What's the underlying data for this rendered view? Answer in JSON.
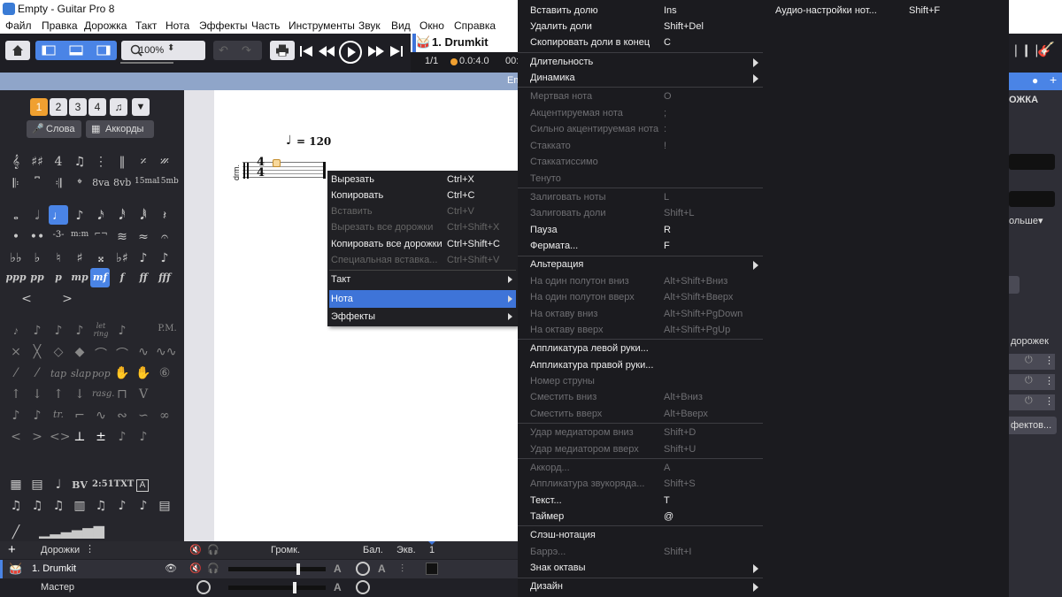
{
  "window": {
    "title": "Empty - Guitar Pro 8"
  },
  "menubar": [
    "Файл",
    "Правка",
    "Дорожка",
    "Такт",
    "Нота",
    "Эффекты",
    "Часть",
    "Инструменты",
    "Звук",
    "Вид",
    "Окно",
    "Справка"
  ],
  "toolbar": {
    "zoom": "100%",
    "track_name": "1. Drumkit",
    "bar_position": "1/1",
    "time_position": "0.0:4.0",
    "time_partial": "00:"
  },
  "track_strip": {
    "title_partial": "Em"
  },
  "palette": {
    "voices": [
      "1",
      "2",
      "3",
      "4"
    ],
    "lyrics_button": "Слова",
    "chords_button": "Аккорды",
    "ottava_labels": [
      "8va",
      "8vb",
      "15ma",
      "15mb"
    ],
    "dynamics": [
      "ppp",
      "pp",
      "p",
      "mp",
      "mf",
      "f",
      "ff",
      "fff"
    ],
    "technique_labels": [
      "tap",
      "slap",
      "pop",
      "rasg.",
      "let ring",
      "P.M."
    ],
    "misc_labels": [
      "BV",
      "2:51",
      "TXT",
      "A"
    ]
  },
  "score": {
    "tempo": "= 120",
    "track_label": "drm."
  },
  "mixer": {
    "header": {
      "tracks_label": "Дорожки",
      "volume_label": "Громк.",
      "balance_label": "Бал.",
      "eq_label": "Экв.",
      "bar_number": "1"
    },
    "rows": [
      {
        "name": "1. Drumkit"
      },
      {
        "name": "Мастер"
      }
    ]
  },
  "right_panel": {
    "labels": [
      "ОЖКА",
      "ольше▾",
      "дорожек",
      "фектов..."
    ]
  },
  "context_menu": {
    "items": [
      {
        "label": "Вырезать",
        "shortcut": "Ctrl+X",
        "disabled": false
      },
      {
        "label": "Копировать",
        "shortcut": "Ctrl+C",
        "disabled": false
      },
      {
        "label": "Вставить",
        "shortcut": "Ctrl+V",
        "disabled": true
      },
      {
        "label": "Вырезать все дорожки",
        "shortcut": "Ctrl+Shift+X",
        "disabled": true
      },
      {
        "label": "Копировать все дорожки",
        "shortcut": "Ctrl+Shift+C",
        "disabled": false
      },
      {
        "label": "Специальная вставка...",
        "shortcut": "Ctrl+Shift+V",
        "disabled": true
      },
      {
        "label": "Такт",
        "shortcut": "",
        "disabled": false,
        "submenu": true
      },
      {
        "label": "Нота",
        "shortcut": "",
        "disabled": false,
        "submenu": true,
        "highlighted": true
      },
      {
        "label": "Эффекты",
        "shortcut": "",
        "disabled": false,
        "submenu": true
      }
    ]
  },
  "note_menu": {
    "items": [
      {
        "label": "Вставить долю",
        "shortcut": "Ins",
        "disabled": false
      },
      {
        "label": "Удалить доли",
        "shortcut": "Shift+Del",
        "disabled": false
      },
      {
        "label": "Скопировать доли в конец",
        "shortcut": "C",
        "disabled": false
      },
      {
        "label": "Длительность",
        "shortcut": "",
        "submenu": true
      },
      {
        "label": "Динамика",
        "shortcut": "",
        "submenu": true
      },
      {
        "label": "Мертвая нота",
        "shortcut": "O",
        "disabled": true
      },
      {
        "label": "Акцентируемая нота",
        "shortcut": ";",
        "disabled": true
      },
      {
        "label": "Сильно акцентируемая нота",
        "shortcut": ":",
        "disabled": true
      },
      {
        "label": "Стаккато",
        "shortcut": "!",
        "disabled": true
      },
      {
        "label": "Стаккатиссимо",
        "shortcut": "",
        "disabled": true
      },
      {
        "label": "Тенуто",
        "shortcut": "",
        "disabled": true
      },
      {
        "label": "Залиговать ноты",
        "shortcut": "L",
        "disabled": true
      },
      {
        "label": "Залиговать доли",
        "shortcut": "Shift+L",
        "disabled": true
      },
      {
        "label": "Пауза",
        "shortcut": "R",
        "disabled": false
      },
      {
        "label": "Фермата...",
        "shortcut": "F",
        "disabled": false
      },
      {
        "label": "Альтерация",
        "shortcut": "",
        "submenu": true
      },
      {
        "label": "На один полутон вниз",
        "shortcut": "Alt+Shift+Вниз",
        "disabled": true
      },
      {
        "label": "На один полутон вверх",
        "shortcut": "Alt+Shift+Вверх",
        "disabled": true
      },
      {
        "label": "На октаву вниз",
        "shortcut": "Alt+Shift+PgDown",
        "disabled": true
      },
      {
        "label": "На октаву вверх",
        "shortcut": "Alt+Shift+PgUp",
        "disabled": true
      },
      {
        "label": "Аппликатура левой руки...",
        "shortcut": "",
        "disabled": false
      },
      {
        "label": "Аппликатура правой руки...",
        "shortcut": "",
        "disabled": false
      },
      {
        "label": "Номер струны",
        "shortcut": "",
        "disabled": true
      },
      {
        "label": "Сместить вниз",
        "shortcut": "Alt+Вниз",
        "disabled": true
      },
      {
        "label": "Сместить вверх",
        "shortcut": "Alt+Вверх",
        "disabled": true
      },
      {
        "label": "Удар медиатором вниз",
        "shortcut": "Shift+D",
        "disabled": true
      },
      {
        "label": "Удар медиатором вверх",
        "shortcut": "Shift+U",
        "disabled": true
      },
      {
        "label": "Аккорд...",
        "shortcut": "A",
        "disabled": true
      },
      {
        "label": "Аппликатура звукоряда...",
        "shortcut": "Shift+S",
        "disabled": true
      },
      {
        "label": "Текст...",
        "shortcut": "T",
        "disabled": false
      },
      {
        "label": "Таймер",
        "shortcut": "@",
        "disabled": false
      },
      {
        "label": "Слэш-нотация",
        "shortcut": "",
        "disabled": false
      },
      {
        "label": "Баррэ...",
        "shortcut": "Shift+I",
        "disabled": true
      },
      {
        "label": "Знак октавы",
        "shortcut": "",
        "submenu": true
      },
      {
        "label": "Дизайн",
        "shortcut": "",
        "submenu": true
      }
    ]
  },
  "effects_menu": {
    "items": [
      {
        "label": "Аудио-настройки нот...",
        "shortcut": "Shift+F"
      }
    ]
  }
}
